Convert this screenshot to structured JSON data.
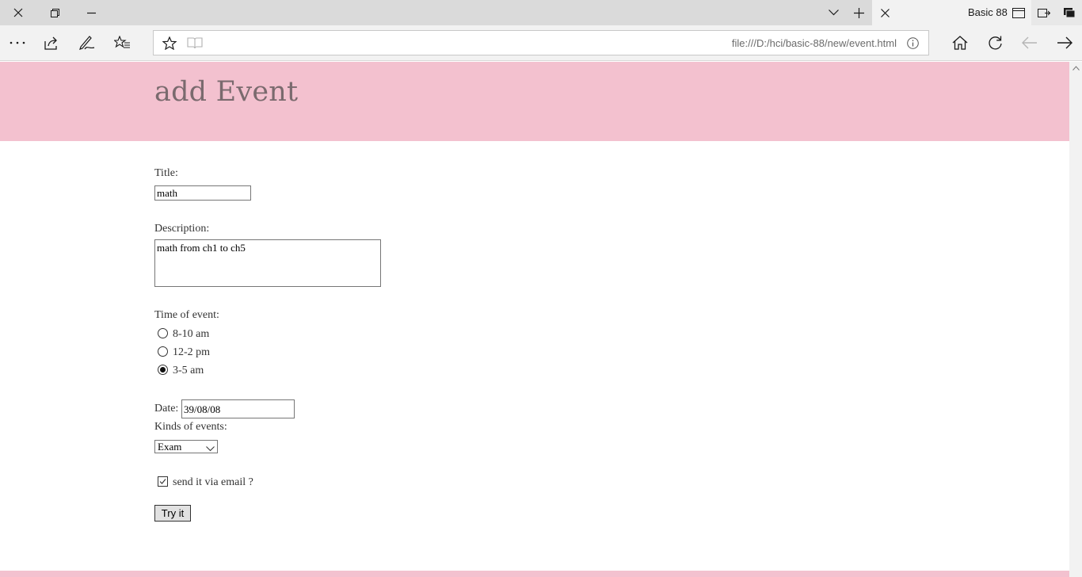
{
  "browser": {
    "tab_title": "Basic 88",
    "url": "file:///D:/hci/basic-88/new/event.html"
  },
  "page": {
    "heading": "add Event",
    "title_label": "Title:",
    "title_value": "math",
    "description_label": "Description:",
    "description_value": "math from ch1 to ch5",
    "time_label": "Time of event:",
    "time_options": [
      {
        "label": "8-10 am",
        "checked": false
      },
      {
        "label": "12-2 pm",
        "checked": false
      },
      {
        "label": "3-5 am",
        "checked": true
      }
    ],
    "date_label": "Date:",
    "date_value": "39/08/08",
    "kinds_label": "Kinds of events:",
    "kinds_selected": "Exam",
    "email_label": "send it via email ?",
    "email_checked": true,
    "submit_label": "Try it"
  },
  "colors": {
    "header_bg": "#f3c1cf",
    "heading_color": "#7a6a6e"
  }
}
